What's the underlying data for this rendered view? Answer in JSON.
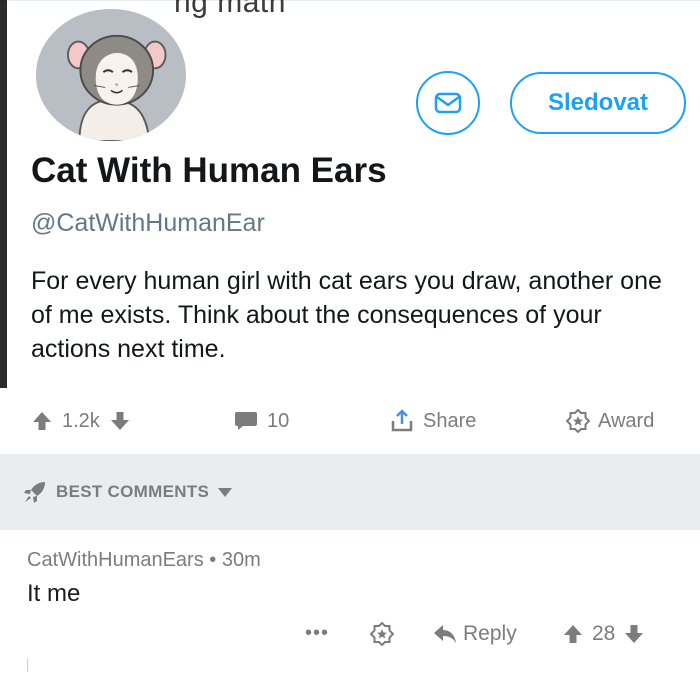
{
  "tweet": {
    "partial_header_text": "ng math",
    "display_name": "Cat With Human Ears",
    "handle": "@CatWithHumanEar",
    "follow_label": "Sledovat",
    "bio": "For every human girl with cat ears you draw, another one of me exists. Think about the consequences of your actions next time.",
    "accent_color": "#1da1f2"
  },
  "actions": {
    "vote_count": "1.2k",
    "comment_count": "10",
    "share_label": "Share",
    "award_label": "Award"
  },
  "sort": {
    "label": "BEST COMMENTS"
  },
  "comment": {
    "author": "CatWithHumanEars",
    "separator": "•",
    "age": "30m",
    "body": "It me",
    "more_label": "•••",
    "reply_label": "Reply",
    "score": "28"
  },
  "icons": {
    "message": "envelope-icon",
    "upvote": "arrow-up-icon",
    "downvote": "arrow-down-icon",
    "comment": "speech-bubble-icon",
    "share": "share-upload-icon",
    "award": "star-badge-icon",
    "sort": "rocket-icon",
    "reply": "reply-arrow-icon"
  }
}
